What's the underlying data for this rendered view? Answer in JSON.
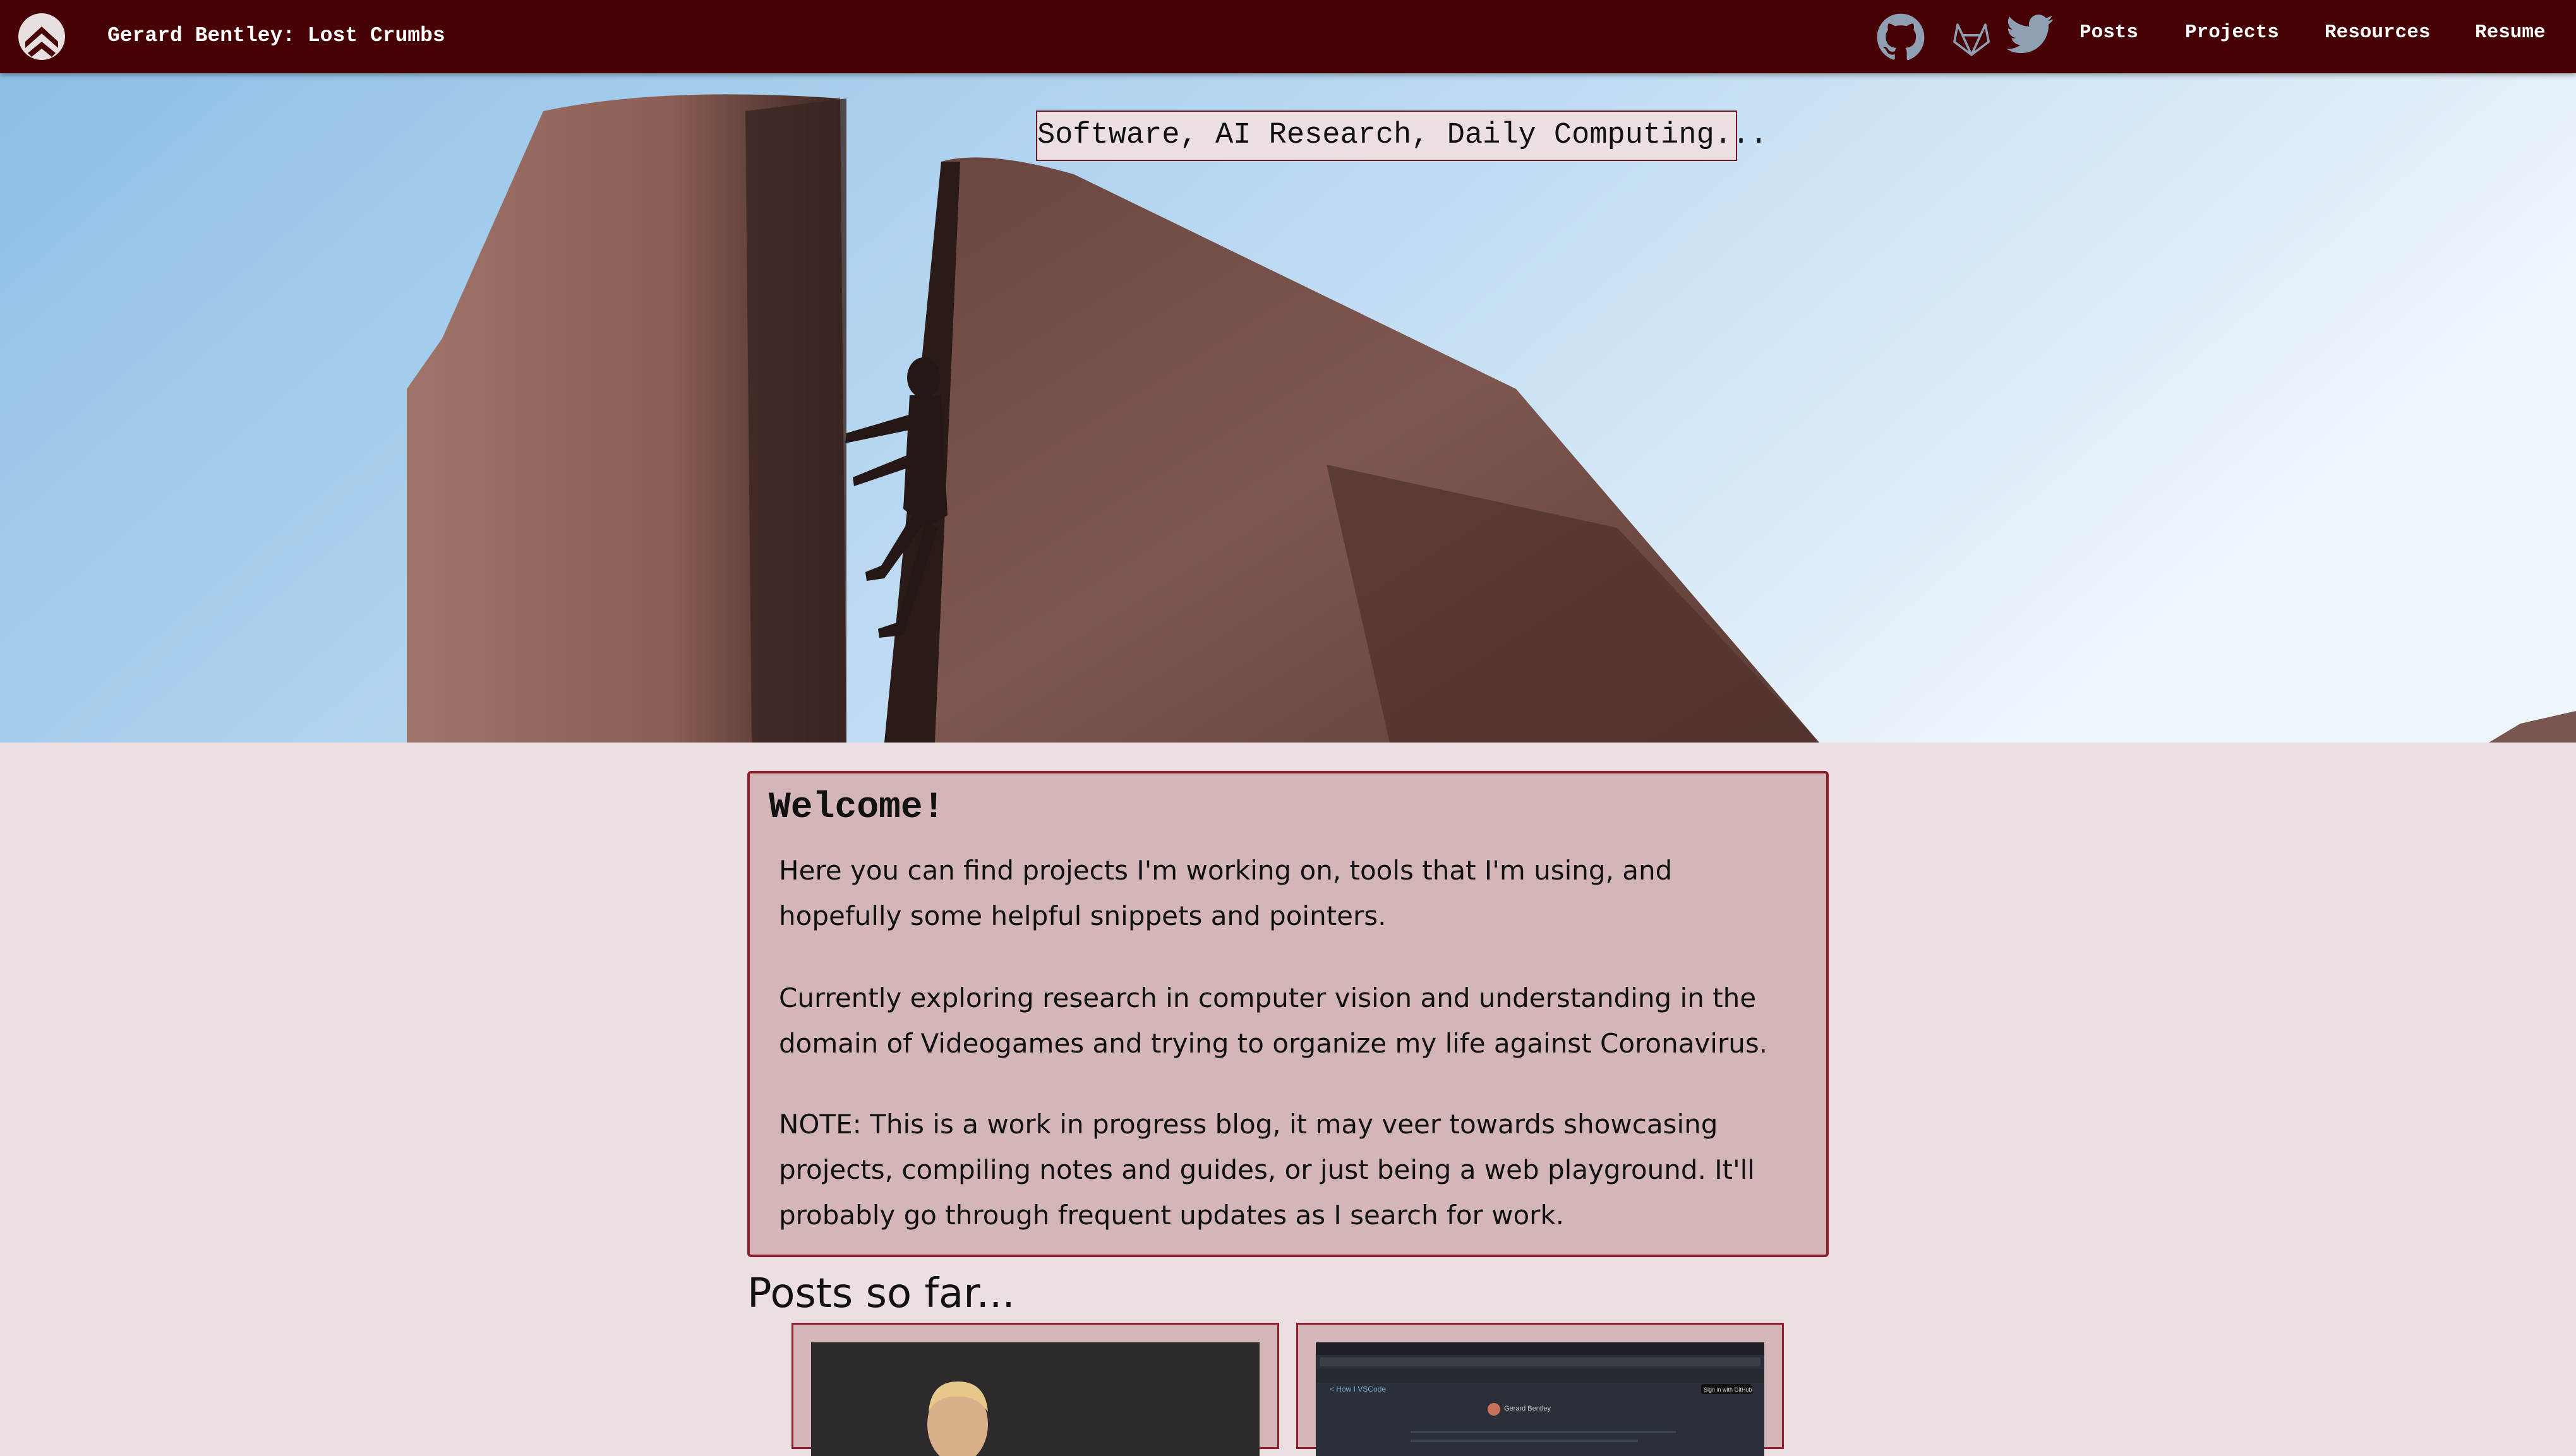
{
  "header": {
    "site_title": "Gerard Bentley: Lost Crumbs",
    "social_icons": [
      "github-icon",
      "gitlab-icon",
      "twitter-icon"
    ],
    "nav": [
      "Posts",
      "Projects",
      "Resources",
      "Resume"
    ]
  },
  "hero": {
    "tagline": "Software, AI Research, Daily Computing..."
  },
  "welcome": {
    "heading": "Welcome!",
    "paragraphs": [
      "Here you can find projects I'm working on, tools that I'm using, and hopefully some helpful snippets and pointers.",
      "Currently exploring research in computer vision and understanding in the domain of Videogames and trying to organize my life against Coronavirus.",
      "NOTE: This is a work in progress blog, it may veer towards showcasing projects, compiling notes and guides, or just being a web playground. It'll probably go through frequent updates as I search for work."
    ]
  },
  "posts": {
    "heading": "Posts so far...",
    "thumbnail_text": {
      "nav_link": "< How I VSCode",
      "author": "Gerard Bentley",
      "button": "Sign in with GitHub"
    }
  },
  "colors": {
    "navbar": "#470004",
    "page_background": "#ecdfe1",
    "card_background": "#d4b5b8",
    "card_border": "#8f1d2c",
    "social_icon": "#8fa0b5"
  }
}
